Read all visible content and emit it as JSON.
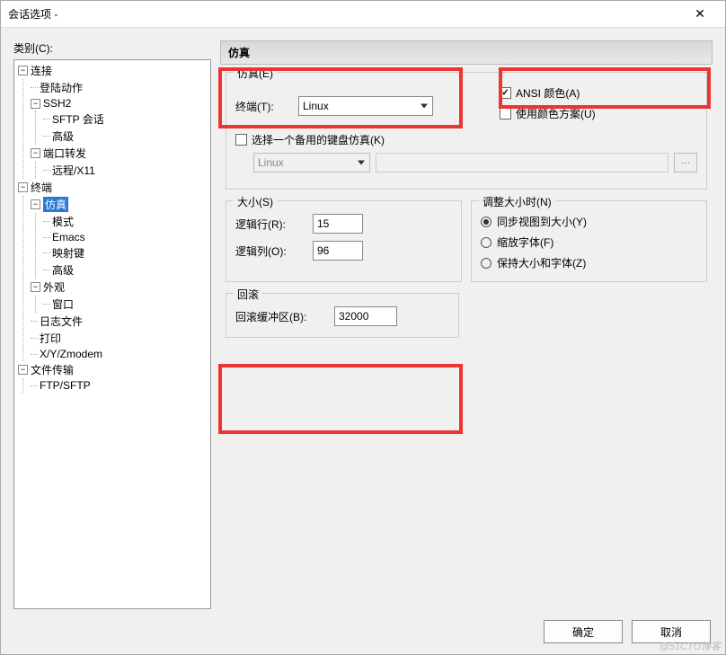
{
  "window": {
    "title": "会话选项 -"
  },
  "sidebar": {
    "label": "类别(C):",
    "tree": {
      "connection": "连接",
      "login": "登陆动作",
      "ssh2": "SSH2",
      "sftp": "SFTP 会话",
      "advanced1": "高级",
      "portfwd": "端口转发",
      "remote": "远程/X11",
      "terminal": "终端",
      "emulation": "仿真",
      "mode": "模式",
      "emacs": "Emacs",
      "mapkeys": "映射键",
      "advanced2": "高级",
      "appearance": "外观",
      "window": "窗口",
      "logfile": "日志文件",
      "print": "打印",
      "xyz": "X/Y/Zmodem",
      "filetransfer": "文件传输",
      "ftpsftp": "FTP/SFTP"
    }
  },
  "main": {
    "header": "仿真",
    "emu_group": "仿真(E)",
    "terminal_label": "终端(T):",
    "terminal_value": "Linux",
    "ansi_color": "ANSI 颜色(A)",
    "use_color_scheme": "使用颜色方案(U)",
    "choose_alt_kb": "选择一个备用的键盘仿真(K)",
    "alt_kb_value": "Linux",
    "size_group": "大小(S)",
    "rows_label": "逻辑行(R):",
    "rows_value": "15",
    "cols_label": "逻辑列(O):",
    "cols_value": "96",
    "resize_group": "调整大小时(N)",
    "resize_sync": "同步视图到大小(Y)",
    "resize_scale": "缩放字体(F)",
    "resize_keep": "保持大小和字体(Z)",
    "scrollback_group": "回滚",
    "scrollback_label": "回滚缓冲区(B):",
    "scrollback_value": "32000",
    "more": "..."
  },
  "footer": {
    "ok": "确定",
    "cancel": "取消"
  },
  "watermark": "@51CTO博客"
}
